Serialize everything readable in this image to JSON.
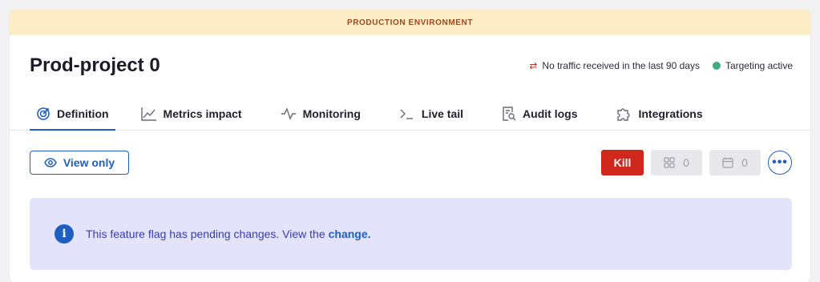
{
  "environment_banner": "PRODUCTION ENVIRONMENT",
  "project_title": "Prod-project 0",
  "status": {
    "traffic": "No traffic received in the last 90 days",
    "targeting": "Targeting active"
  },
  "tabs": [
    {
      "label": "Definition",
      "icon": "target-icon",
      "active": true
    },
    {
      "label": "Metrics impact",
      "icon": "line-chart-icon"
    },
    {
      "label": "Monitoring",
      "icon": "pulse-icon"
    },
    {
      "label": "Live tail",
      "icon": "terminal-icon"
    },
    {
      "label": "Audit logs",
      "icon": "document-search-icon"
    },
    {
      "label": "Integrations",
      "icon": "puzzle-icon"
    }
  ],
  "toolbar": {
    "view_only_label": "View only",
    "kill_label": "Kill",
    "segments_count": "0",
    "schedules_count": "0",
    "more_label": "•••"
  },
  "notice": {
    "text": "This feature flag has pending changes. View the",
    "link": "change."
  },
  "colors": {
    "accent": "#1f5fbf",
    "kill": "#d0271d",
    "banner": "#fcedc7",
    "notice_bg": "#e3e3fb",
    "active_dot": "#3fae7a"
  }
}
